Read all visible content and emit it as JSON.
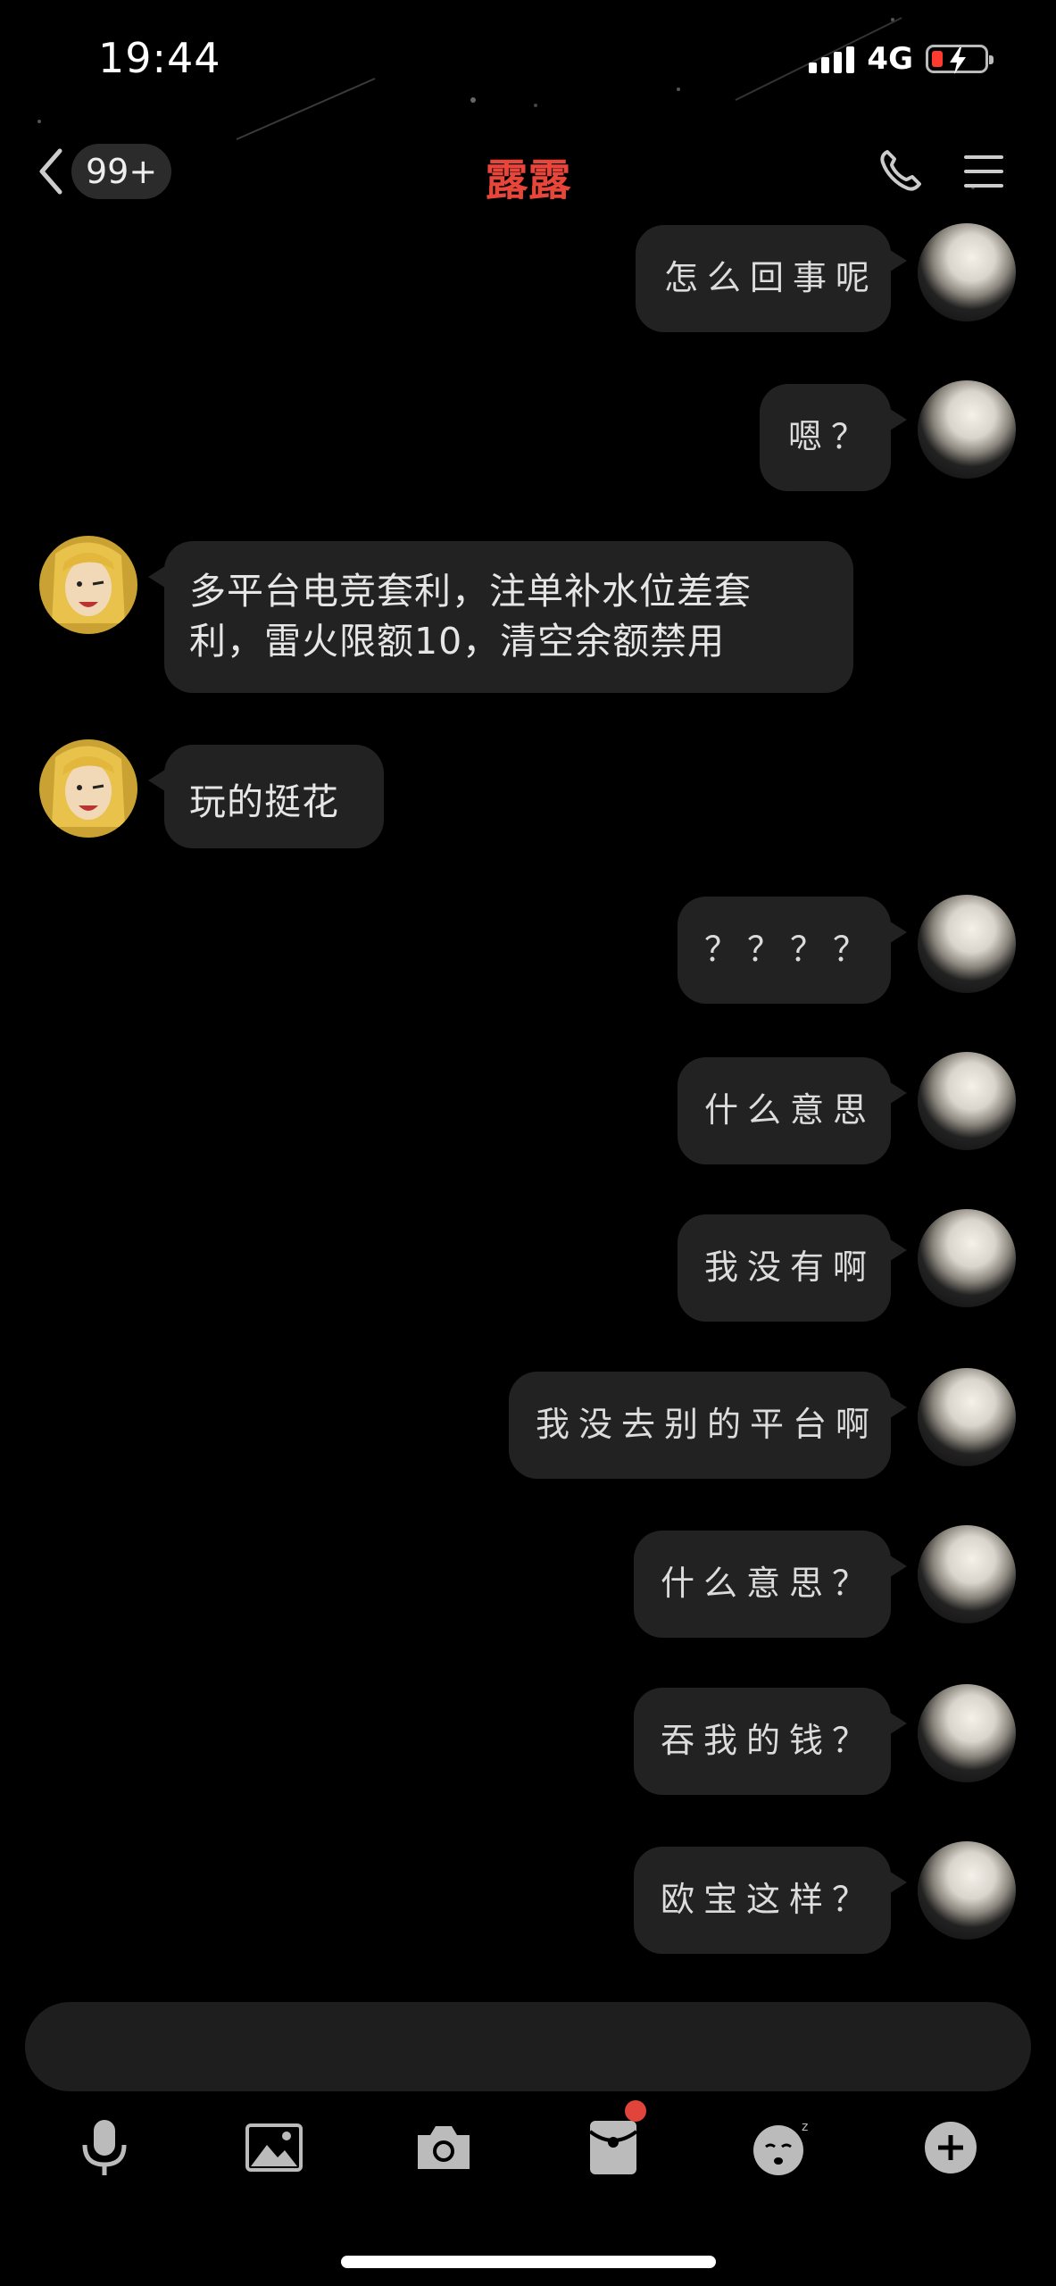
{
  "status_bar": {
    "time": "19:44",
    "network": "4G"
  },
  "header": {
    "unread_count": "99+",
    "title": "露露"
  },
  "messages": [
    {
      "side": "right",
      "text": "怎么回事呢"
    },
    {
      "side": "right",
      "text": "嗯？"
    },
    {
      "side": "left",
      "lines": [
        "多平台电竞套利，注单补水位差套",
        "利，雷火限额10，清空余额禁用"
      ]
    },
    {
      "side": "left",
      "text": "玩的挺花"
    },
    {
      "side": "right",
      "text": "？？？？"
    },
    {
      "side": "right",
      "text": "什么意思"
    },
    {
      "side": "right",
      "text": "我没有啊"
    },
    {
      "side": "right",
      "text": "我没去别的平台啊"
    },
    {
      "side": "right",
      "text": "什么意思？"
    },
    {
      "side": "right",
      "text": "吞我的钱？"
    },
    {
      "side": "right",
      "text": "欧宝这样？"
    }
  ],
  "colors": {
    "title": "#e8463a",
    "bubble": "#222222",
    "badge_dot": "#e0443a"
  },
  "icons": [
    "back-chevron-icon",
    "phone-icon",
    "menu-icon",
    "microphone-icon",
    "image-icon",
    "camera-icon",
    "red-packet-icon",
    "emoji-icon",
    "plus-icon"
  ]
}
